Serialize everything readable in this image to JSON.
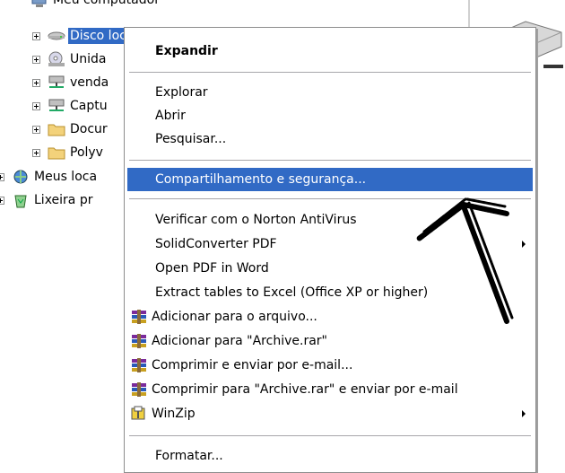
{
  "tree": {
    "items": [
      {
        "label": "Meu computador",
        "icon": "my-computer-icon"
      },
      {
        "label": "Disco local (C:)",
        "icon": "hard-drive-icon",
        "selected": true
      },
      {
        "label": "Unida",
        "icon": "cd-drive-icon"
      },
      {
        "label": "venda",
        "icon": "network-drive-icon"
      },
      {
        "label": "Captu",
        "icon": "network-drive-icon"
      },
      {
        "label": "Docur",
        "icon": "folder-icon"
      },
      {
        "label": "Polyv",
        "icon": "folder-icon"
      },
      {
        "label": "Meus loca",
        "icon": "network-places-icon"
      },
      {
        "label": "Lixeira pr",
        "icon": "recycle-bin-icon"
      }
    ]
  },
  "context_menu": {
    "items": [
      {
        "label": "Expandir",
        "bold": true
      },
      {
        "label": "Explorar"
      },
      {
        "label": "Abrir"
      },
      {
        "label": "Pesquisar..."
      },
      {
        "label": "Compartilhamento e segurança...",
        "highlighted": true
      },
      {
        "label": "Verificar com o Norton AntiVirus"
      },
      {
        "label": "SolidConverter PDF",
        "submenu": true
      },
      {
        "label": "Open PDF in Word"
      },
      {
        "label": "Extract tables to Excel (Office XP or higher)"
      },
      {
        "label": "Adicionar para o arquivo...",
        "icon": "winrar-icon"
      },
      {
        "label": "Adicionar para \"Archive.rar\"",
        "icon": "winrar-icon"
      },
      {
        "label": "Comprimir e enviar por e-mail...",
        "icon": "winrar-icon"
      },
      {
        "label": "Comprimir para \"Archive.rar\" e enviar por e-mail",
        "icon": "winrar-icon"
      },
      {
        "label": "WinZip",
        "icon": "winzip-icon",
        "submenu": true
      },
      {
        "label": "Formatar..."
      }
    ]
  },
  "colors": {
    "selection": "#316ac5",
    "separator": "#a7a6aa",
    "folder": "#f3d27b"
  }
}
